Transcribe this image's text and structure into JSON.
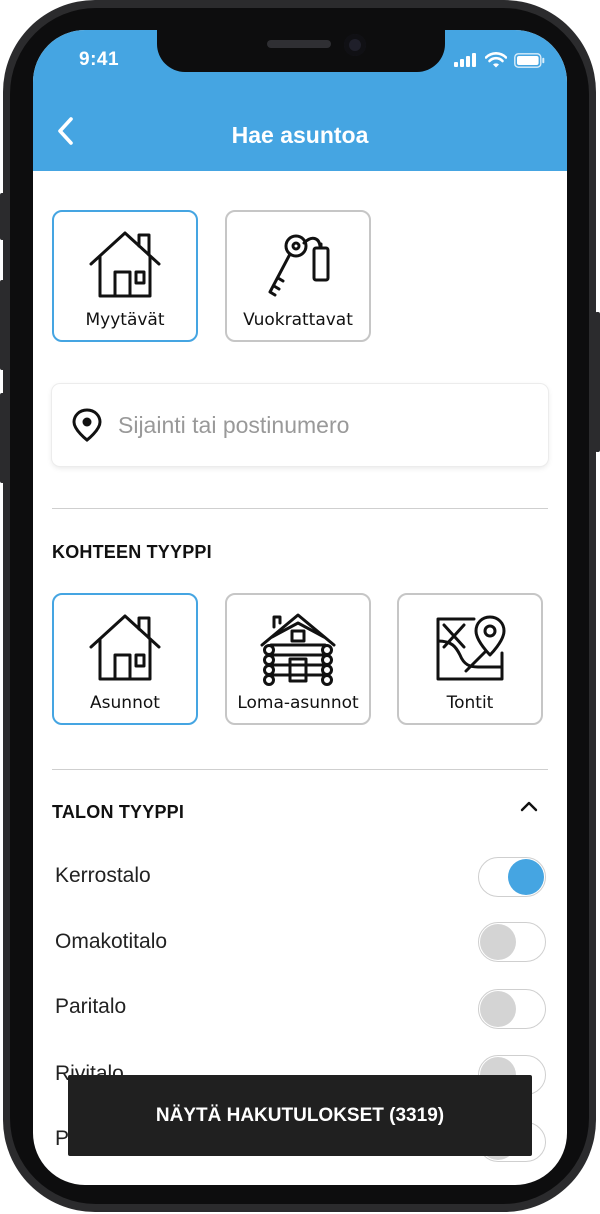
{
  "status_bar": {
    "time": "9:41"
  },
  "header": {
    "title": "Hae asuntoa",
    "back_icon": "chevron-left-icon"
  },
  "listing_types": [
    {
      "label": "Myytävät",
      "icon": "house-icon",
      "selected": true
    },
    {
      "label": "Vuokrattavat",
      "icon": "key-tag-icon",
      "selected": false
    }
  ],
  "search": {
    "placeholder": "Sijainti tai postinumero",
    "value": "",
    "icon": "location-pin-icon"
  },
  "property_type": {
    "title": "KOHTEEN TYYPPI",
    "items": [
      {
        "label": "Asunnot",
        "icon": "house-icon",
        "selected": true
      },
      {
        "label": "Loma-asunnot",
        "icon": "log-cabin-icon",
        "selected": false
      },
      {
        "label": "Tontit",
        "icon": "map-pin-icon",
        "selected": false
      }
    ]
  },
  "house_type": {
    "title": "TALON TYYPPI",
    "collapse_icon": "chevron-up-icon",
    "options": [
      {
        "label": "Kerrostalo",
        "on": true
      },
      {
        "label": "Omakotitalo",
        "on": false
      },
      {
        "label": "Paritalo",
        "on": false
      },
      {
        "label": "Rivitalo",
        "on": false
      },
      {
        "label": "P",
        "on": false
      }
    ]
  },
  "results_button": {
    "label": "NÄYTÄ HAKUTULOKSET (3319)"
  },
  "colors": {
    "accent": "#45a5e2",
    "dark_button": "#202020"
  }
}
